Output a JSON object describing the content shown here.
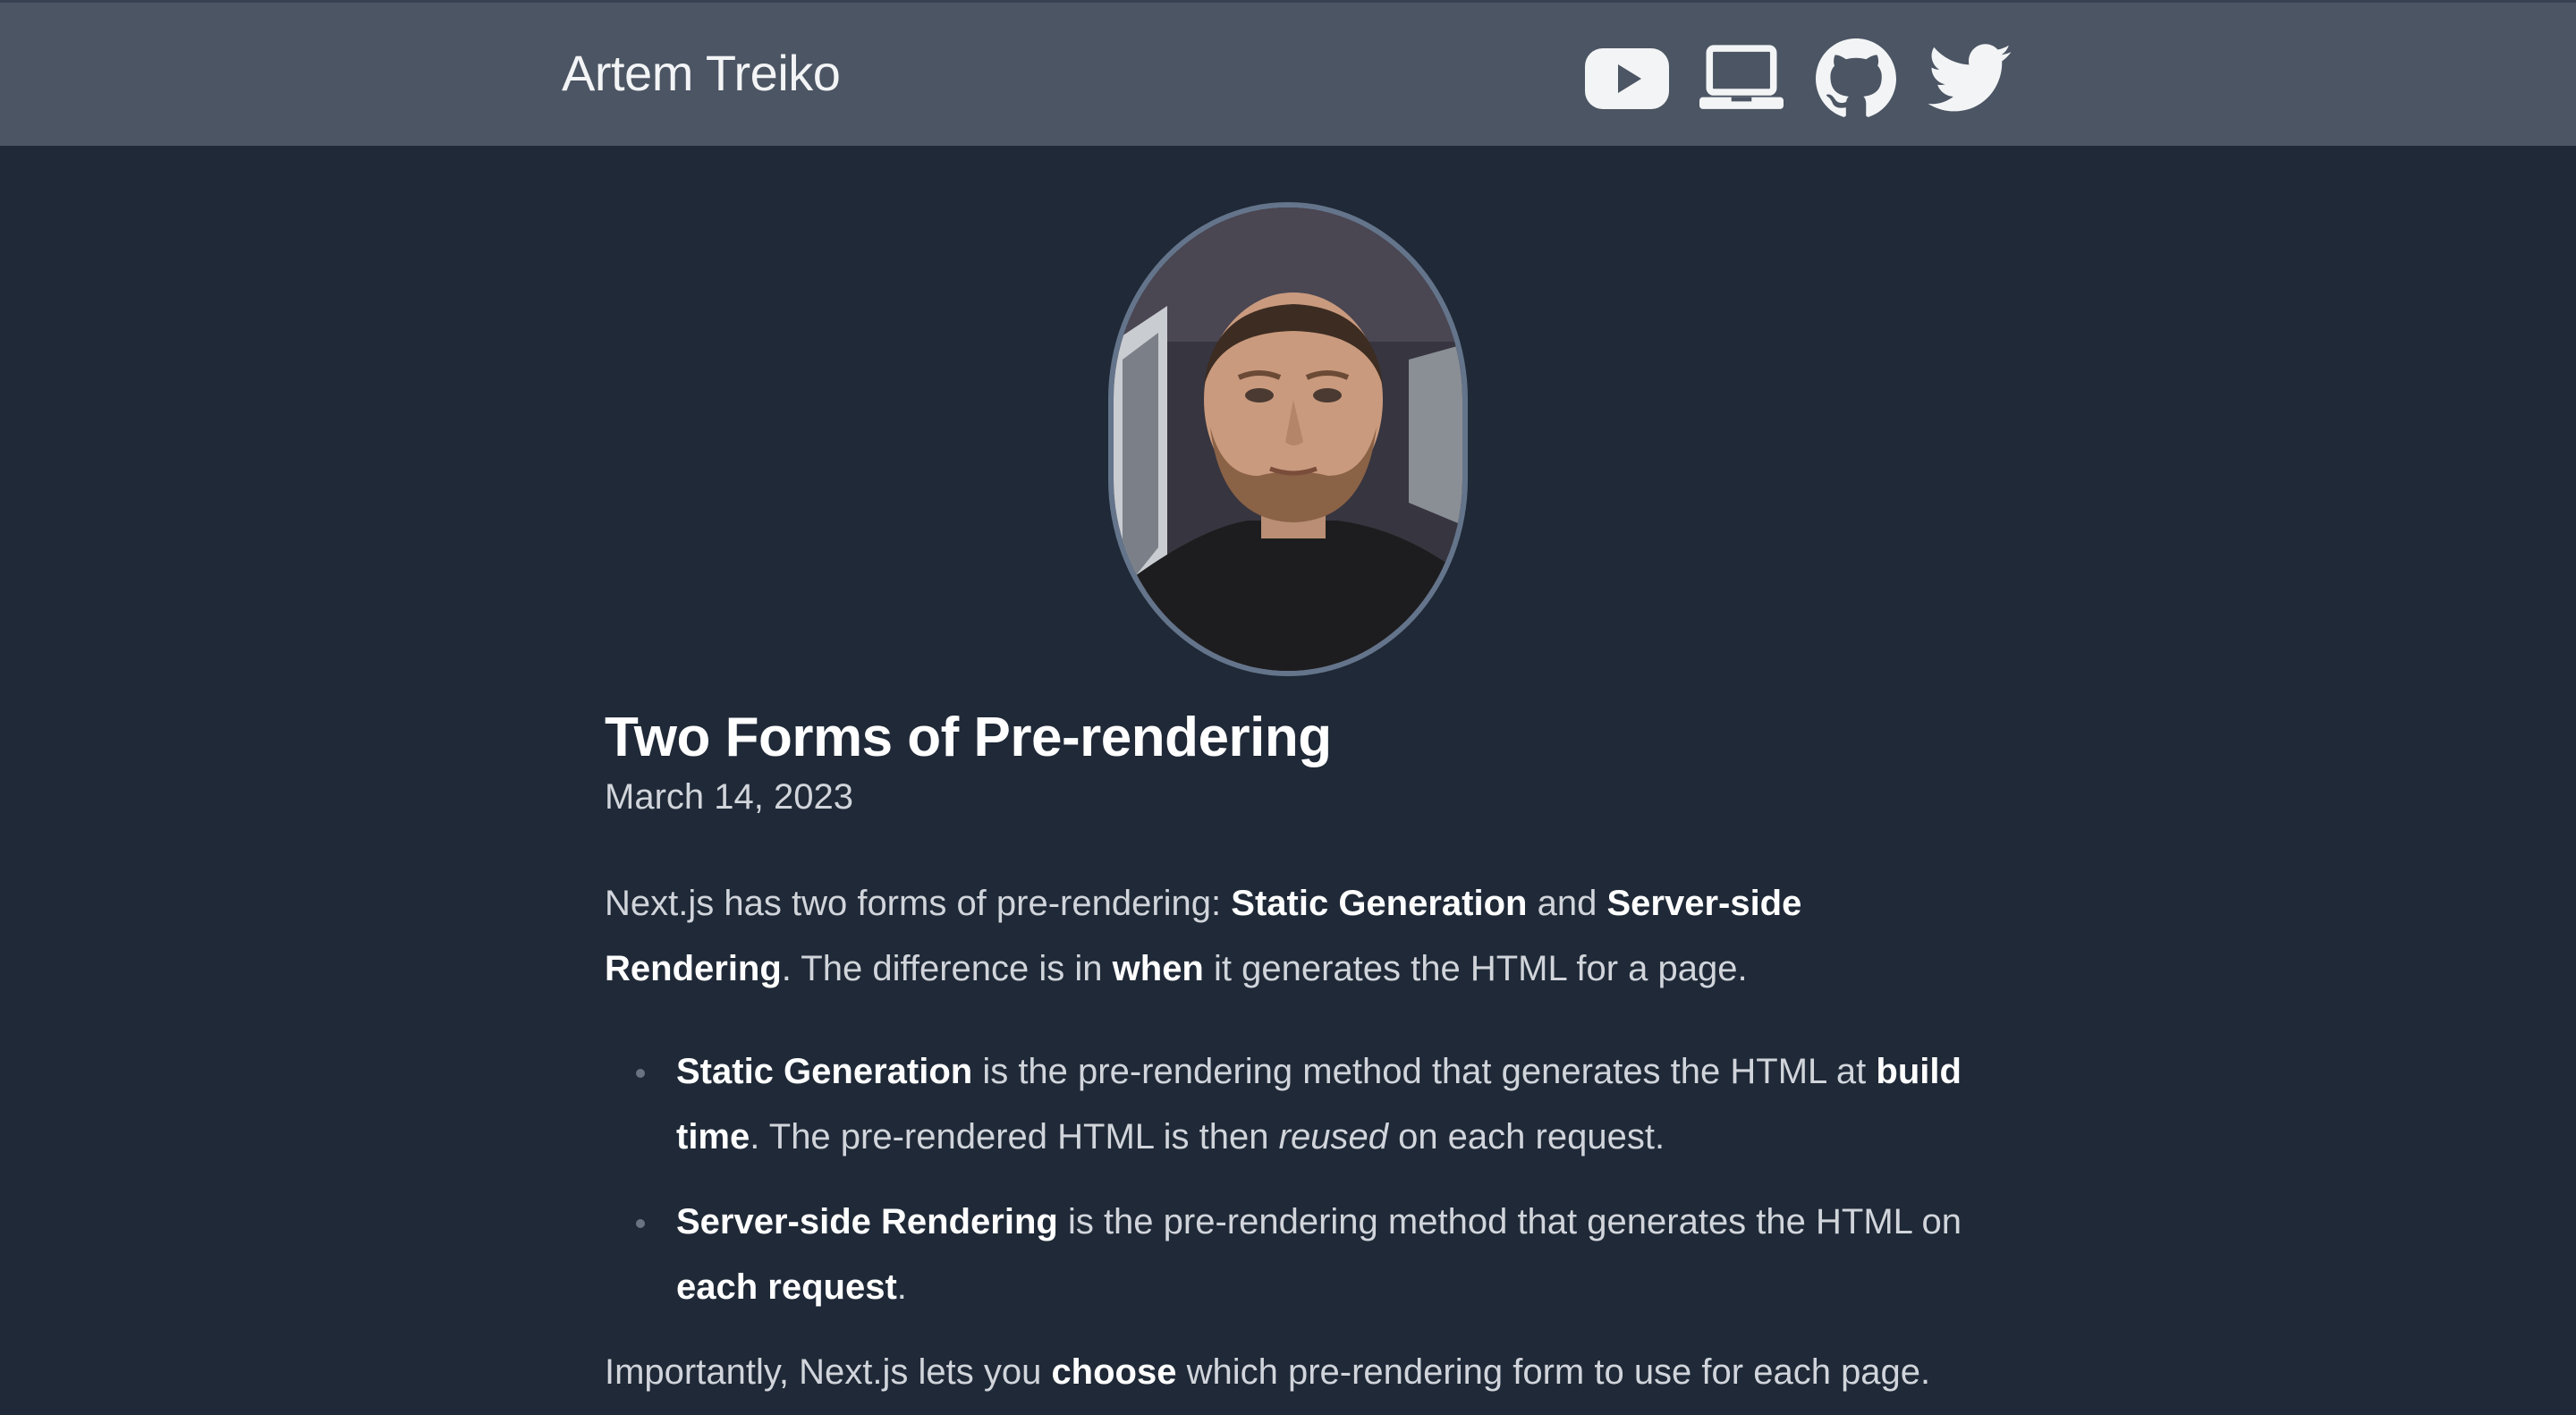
{
  "header": {
    "site_title": "Artem Treiko",
    "links": [
      {
        "name": "youtube-icon"
      },
      {
        "name": "laptop-icon"
      },
      {
        "name": "github-icon"
      },
      {
        "name": "twitter-icon"
      }
    ]
  },
  "avatar": {
    "alt_description": "profile-photo"
  },
  "post": {
    "title": "Two Forms of Pre-rendering",
    "date": "March 14, 2023",
    "intro": {
      "t1": "Next.js has two forms of pre-rendering: ",
      "b1": "Static Generation",
      "t2": " and ",
      "b2": "Server-side Rendering",
      "t3": ". The difference is in ",
      "b3": "when",
      "t4": " it generates the HTML for a page."
    },
    "bullets": [
      {
        "b1": "Static Generation",
        "t1": " is the pre-rendering method that generates the HTML at ",
        "b2": "build time",
        "t2": ". The pre-rendered HTML is then ",
        "i1": "reused",
        "t3": " on each request."
      },
      {
        "b1": "Server-side Rendering",
        "t1": " is the pre-rendering method that generates the HTML on ",
        "b2": "each request",
        "t2": "."
      }
    ],
    "last": {
      "t1": "Importantly, Next.js lets you ",
      "b1": "choose",
      "t2": " which pre-rendering form to use for each page."
    }
  },
  "colors": {
    "background": "#1f2937",
    "header": "#4b5563",
    "text": "#d1d5db",
    "accent": "#ffffff"
  }
}
